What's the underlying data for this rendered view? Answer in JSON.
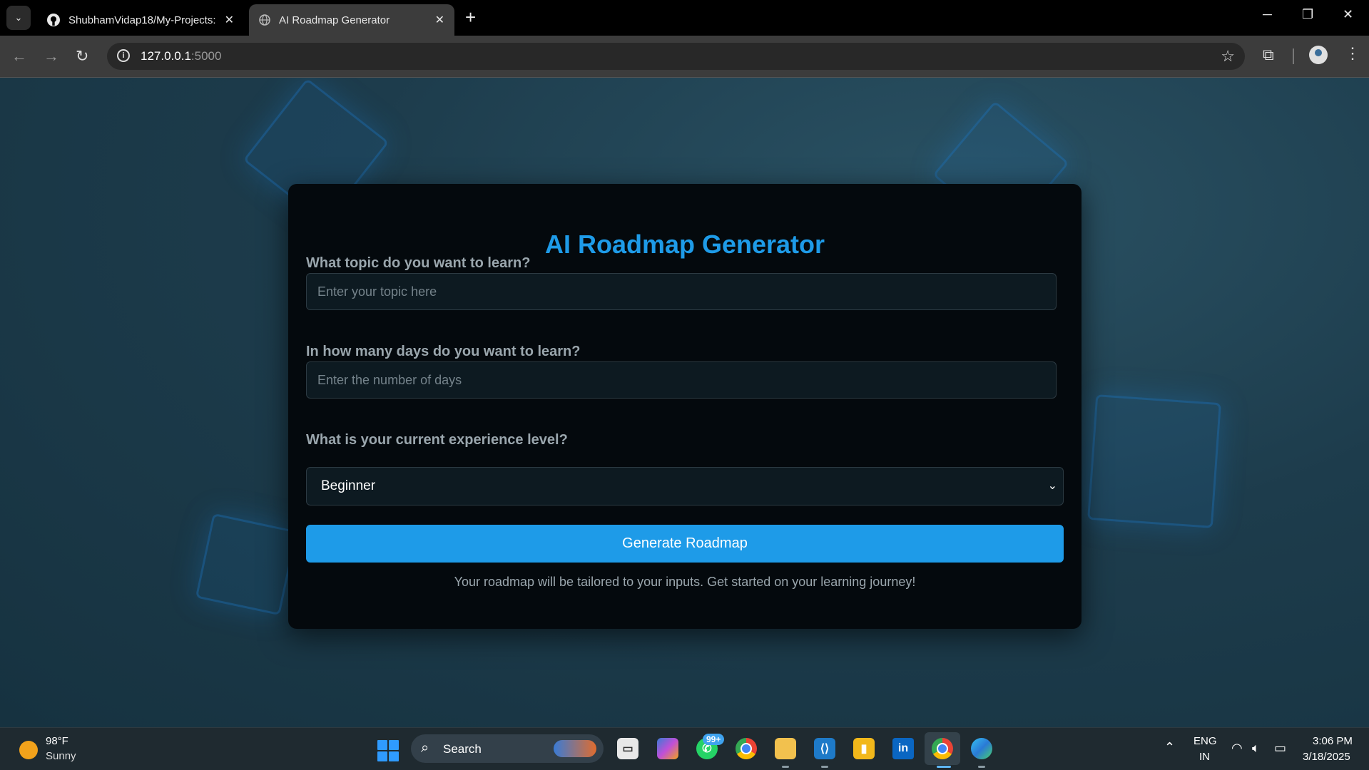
{
  "browser": {
    "tabs": [
      {
        "title": "ShubhamVidap18/My-Projects:"
      },
      {
        "title": "AI Roadmap Generator"
      }
    ],
    "url_host": "127.0.0.1",
    "url_port": ":5000"
  },
  "form": {
    "title": "AI Roadmap Generator",
    "topic_label": "What topic do you want to learn?",
    "topic_placeholder": "Enter your topic here",
    "days_label": "In how many days do you want to learn?",
    "days_placeholder": "Enter the number of days",
    "level_label": "What is your current experience level?",
    "level_selected": "Beginner",
    "submit_label": "Generate Roadmap",
    "footer_text": "Your roadmap will be tailored to your inputs. Get started on your learning journey!"
  },
  "taskbar": {
    "weather_temp": "98°F",
    "weather_condition": "Sunny",
    "search_label": "Search",
    "whatsapp_badge": "99+",
    "lang_line1": "ENG",
    "lang_line2": "IN",
    "time": "3:06 PM",
    "date": "3/18/2025"
  },
  "colors": {
    "accent": "#1e9be8",
    "card_bg": "#04090d"
  }
}
